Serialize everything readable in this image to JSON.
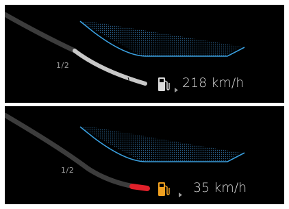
{
  "panels": [
    {
      "fraction_label": "1/2",
      "speed_text": "218 km/h",
      "fuel_icon": "fuel-pump-icon",
      "fuel_icon_color": "#d9d9d9",
      "tail_color": "#c8c8c8",
      "lane_color": "#3aa0e0"
    },
    {
      "fraction_label": "1/2",
      "speed_text": "35 km/h",
      "fuel_icon": "fuel-pump-icon",
      "fuel_icon_color": "#f0a020",
      "tail_color": "#e0202a",
      "lane_color": "#3aa0e0"
    }
  ]
}
